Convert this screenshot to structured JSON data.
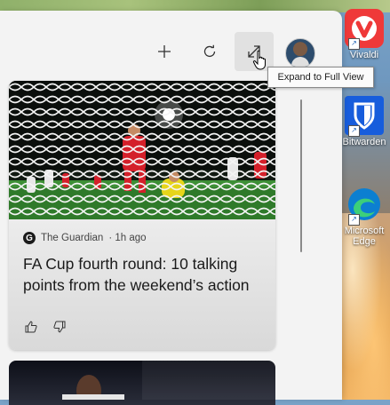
{
  "toolbar": {
    "add_icon": "plus-icon",
    "refresh_icon": "refresh-icon",
    "expand_icon": "expand-icon"
  },
  "tooltip": {
    "text": "Expand to Full View"
  },
  "card": {
    "source": "The Guardian",
    "time": "· 1h ago",
    "headline": "FA Cup fourth round: 10 talking points from the weekend’s action",
    "like_icon": "thumbs-up-icon",
    "dislike_icon": "thumbs-down-icon"
  },
  "desktop": {
    "icons": [
      {
        "label": "Vivaldi",
        "color": "#ef3939"
      },
      {
        "label": "Bitwarden",
        "color": "#175ddc"
      },
      {
        "label": "Microsoft Edge",
        "color": "#0c7fd1"
      }
    ]
  }
}
